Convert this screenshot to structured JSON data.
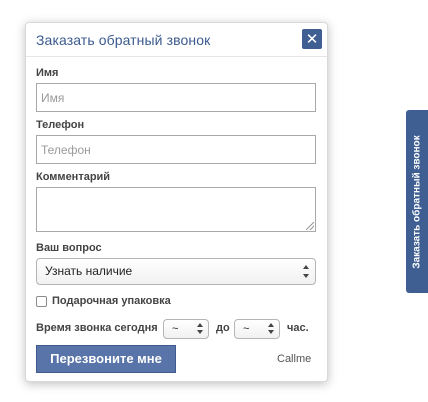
{
  "modal": {
    "title": "Заказать обратный звонок",
    "close_symbol": "✕"
  },
  "form": {
    "name_label": "Имя",
    "name_placeholder": "Имя",
    "phone_label": "Телефон",
    "phone_placeholder": "Телефон",
    "comment_label": "Комментарий",
    "question_label": "Ваш вопрос",
    "question_selected": "Узнать наличие",
    "gift_label": "Подарочная упаковка",
    "gift_checked": false,
    "time_label": "Время звонка сегодня",
    "time_from": "~",
    "time_to_label": "до",
    "time_to": "~",
    "hours_label": "час.",
    "submit_label": "Перезвоните мне",
    "brand": "Callme"
  },
  "side_tab": {
    "label": "Заказать обратный звонок"
  },
  "colors": {
    "accent": "#3f5f92",
    "button": "#5874a8",
    "title_text": "#3b5a8f"
  }
}
